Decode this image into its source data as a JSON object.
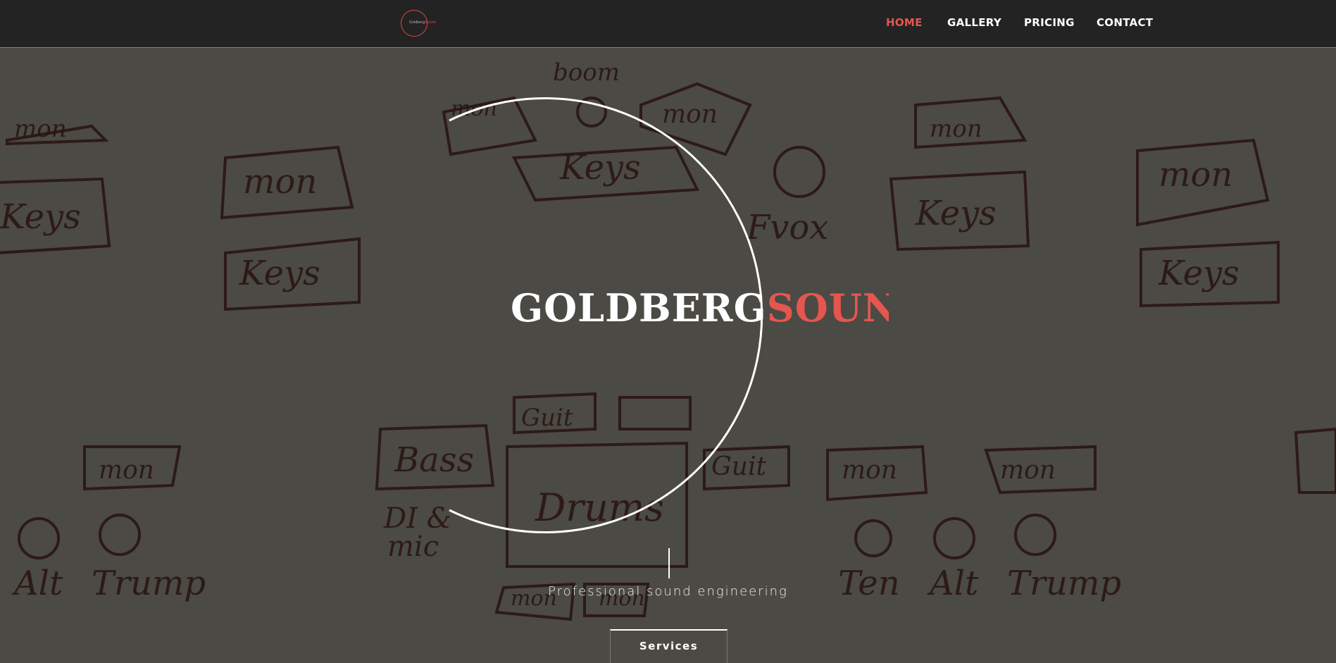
{
  "header": {
    "logo": {
      "text_white": "Goldberg",
      "text_red": "Sound"
    },
    "nav": [
      {
        "label": "HOME",
        "active": true
      },
      {
        "label": "GALLERY",
        "active": false
      },
      {
        "label": "PRICING",
        "active": false
      },
      {
        "label": "CONTACT",
        "active": false
      }
    ]
  },
  "hero": {
    "background_sketch_words": [
      "mon",
      "boom",
      "mon",
      "mon",
      "Keys",
      "Fvox",
      "mon",
      "Keys",
      "Keys",
      "Keys",
      "Keys",
      "Guit",
      "Bass",
      "Guit",
      "Drums",
      "mon",
      "mon",
      "mon",
      "DI &",
      "mic",
      "Alt",
      "Trump",
      "Ten",
      "Alt",
      "Trump",
      "mon",
      "mon",
      "mon"
    ],
    "title_white": "GOLDBERG",
    "title_red": "SOUND",
    "tagline": "Professional sound engineering",
    "cta_label": "Services"
  },
  "colors": {
    "header_bg": "#232323",
    "accent": "#e5564f",
    "hero_bg": "#4b4a44",
    "sketch_ink": "#2a1512"
  }
}
